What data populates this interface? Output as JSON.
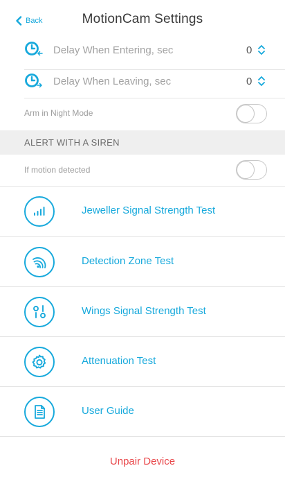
{
  "header": {
    "back_label": "Back",
    "title": "MotionCam Settings"
  },
  "delay_entering": {
    "label": "Delay When Entering, sec",
    "value": "0",
    "icon": "clock-enter-icon"
  },
  "delay_leaving": {
    "label": "Delay When Leaving, sec",
    "value": "0",
    "icon": "clock-leave-icon"
  },
  "arm_night_mode": {
    "label": "Arm in Night Mode",
    "enabled": false
  },
  "siren_section": {
    "title": "ALERT WITH A SIREN"
  },
  "motion_detected": {
    "label": "If motion detected",
    "enabled": false
  },
  "actions": [
    {
      "label": "Jeweller Signal Strength Test",
      "icon": "signal-bars-icon"
    },
    {
      "label": "Detection Zone Test",
      "icon": "detection-zone-icon"
    },
    {
      "label": "Wings Signal Strength Test",
      "icon": "wings-signal-icon"
    },
    {
      "label": "Attenuation Test",
      "icon": "gear-icon"
    },
    {
      "label": "User Guide",
      "icon": "document-icon"
    }
  ],
  "unpair": {
    "label": "Unpair Device"
  },
  "colors": {
    "accent": "#17a9dc",
    "danger": "#e8474a",
    "section_bg": "#efefef",
    "divider": "#e4e4e4"
  }
}
